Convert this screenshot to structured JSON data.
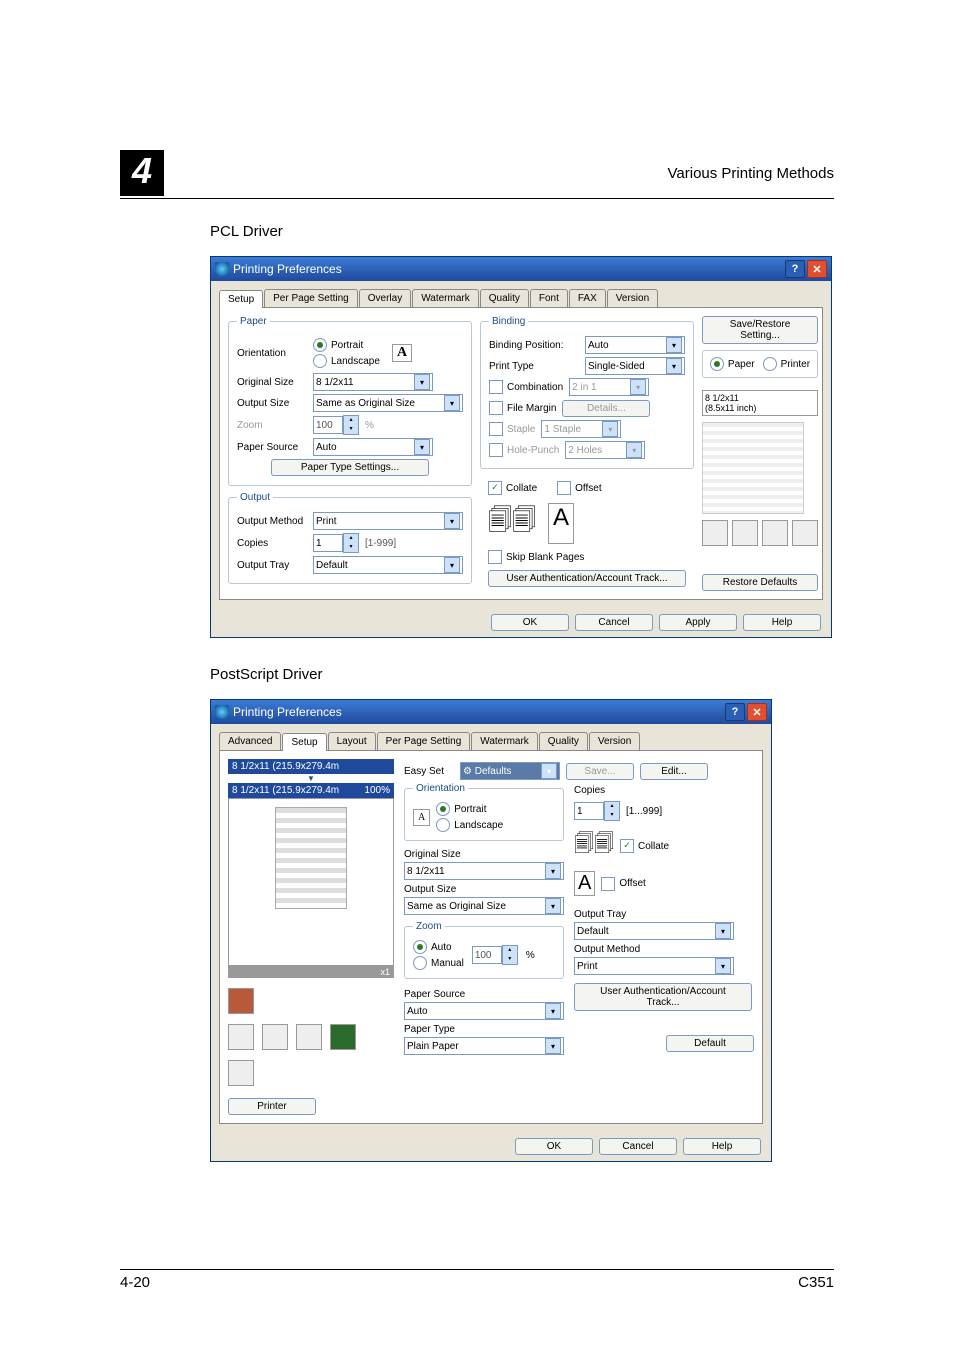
{
  "header": {
    "chapter": "4",
    "title": "Various Printing Methods"
  },
  "section1": "PCL Driver",
  "section2": "PostScript Driver",
  "footer": {
    "left": "4-20",
    "right": "C351"
  },
  "dlg": {
    "title": "Printing Preferences",
    "help_icon": "?",
    "close_icon": "✕"
  },
  "pcl": {
    "tabs": [
      "Setup",
      "Per Page Setting",
      "Overlay",
      "Watermark",
      "Quality",
      "Font",
      "FAX",
      "Version"
    ],
    "active_tab": 0,
    "paper": {
      "legend": "Paper",
      "orientation_label": "Orientation",
      "portrait": "Portrait",
      "landscape": "Landscape",
      "original_size_label": "Original Size",
      "original_size_value": "8 1/2x11",
      "output_size_label": "Output Size",
      "output_size_value": "Same as Original Size",
      "zoom_label": "Zoom",
      "zoom_value": "100",
      "zoom_unit": "%",
      "paper_source_label": "Paper Source",
      "paper_source_value": "Auto",
      "paper_type_btn": "Paper Type Settings..."
    },
    "binding": {
      "legend": "Binding",
      "binding_position_label": "Binding Position:",
      "binding_position_value": "Auto",
      "print_type_label": "Print Type",
      "print_type_value": "Single-Sided",
      "combination": "Combination",
      "combination_value": "2 in 1",
      "file_margin": "File Margin",
      "details_btn": "Details...",
      "staple": "Staple",
      "staple_value": "1 Staple",
      "hole_punch": "Hole-Punch",
      "hole_punch_value": "2 Holes"
    },
    "output": {
      "legend": "Output",
      "output_method_label": "Output Method",
      "output_method_value": "Print",
      "copies_label": "Copies",
      "copies_value": "1",
      "copies_range": "[1-999]",
      "output_tray_label": "Output Tray",
      "output_tray_value": "Default",
      "collate": "Collate",
      "offset": "Offset",
      "skip_blank": "Skip Blank Pages",
      "user_auth_btn": "User Authentication/Account Track..."
    },
    "right": {
      "save_restore_btn": "Save/Restore Setting...",
      "paper_radio": "Paper",
      "printer_radio": "Printer",
      "info1": "8 1/2x11",
      "info2": "(8.5x11 inch)",
      "restore_btn": "Restore Defaults"
    },
    "buttons": {
      "ok": "OK",
      "cancel": "Cancel",
      "apply": "Apply",
      "help": "Help"
    }
  },
  "ps": {
    "tabs": [
      "Advanced",
      "Setup",
      "Layout",
      "Per Page Setting",
      "Watermark",
      "Quality",
      "Version"
    ],
    "active_tab": 1,
    "left": {
      "info1": "8 1/2x11 (215.9x279.4m",
      "info2": "8 1/2x11 (215.9x279.4m",
      "zoom": "100%",
      "x1": "x1",
      "printer_btn": "Printer"
    },
    "center": {
      "easyset_label": "Easy Set",
      "defaults_value": "Defaults",
      "save_btn": "Save...",
      "edit_btn": "Edit...",
      "orientation_legend": "Orientation",
      "portrait": "Portrait",
      "landscape": "Landscape",
      "original_size_label": "Original Size",
      "original_size_value": "8 1/2x11",
      "output_size_label": "Output Size",
      "output_size_value": "Same as Original Size",
      "zoom_legend": "Zoom",
      "auto": "Auto",
      "manual": "Manual",
      "zoom_value": "100",
      "zoom_unit": "%",
      "paper_source_label": "Paper Source",
      "paper_source_value": "Auto",
      "paper_type_label": "Paper Type",
      "paper_type_value": "Plain Paper"
    },
    "right": {
      "copies_label": "Copies",
      "copies_value": "1",
      "copies_range": "[1...999]",
      "collate": "Collate",
      "offset": "Offset",
      "output_tray_label": "Output Tray",
      "output_tray_value": "Default",
      "output_method_label": "Output Method",
      "output_method_value": "Print",
      "user_auth_btn": "User Authentication/Account Track...",
      "default_btn": "Default"
    },
    "buttons": {
      "ok": "OK",
      "cancel": "Cancel",
      "help": "Help"
    }
  }
}
